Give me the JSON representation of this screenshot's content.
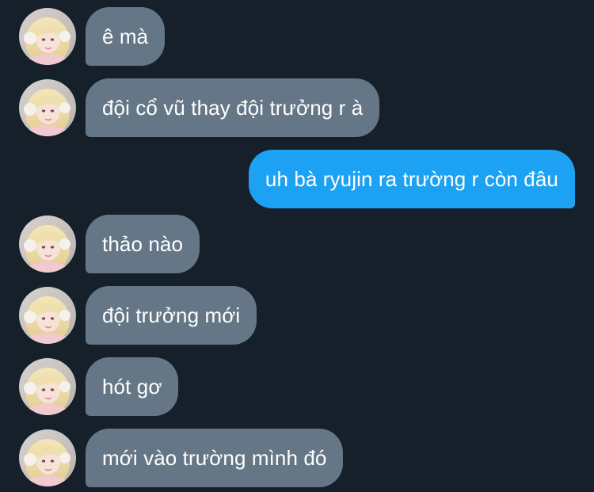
{
  "colors": {
    "background": "#15202b",
    "incoming_bubble": "#657786",
    "outgoing_bubble": "#1da1f2",
    "text": "#ffffff"
  },
  "contact": {
    "avatar_icon": "profile-photo-icon"
  },
  "messages": [
    {
      "direction": "in",
      "text": "ê mà"
    },
    {
      "direction": "in",
      "text": "đội cổ vũ thay đội trưởng r à"
    },
    {
      "direction": "out",
      "text": "uh bà ryujin ra trường r còn đâu"
    },
    {
      "direction": "in",
      "text": "thảo nào"
    },
    {
      "direction": "in",
      "text": "đội trưởng mới"
    },
    {
      "direction": "in",
      "text": "hót gơ"
    },
    {
      "direction": "in",
      "text": "mới vào trường mình đó"
    }
  ]
}
